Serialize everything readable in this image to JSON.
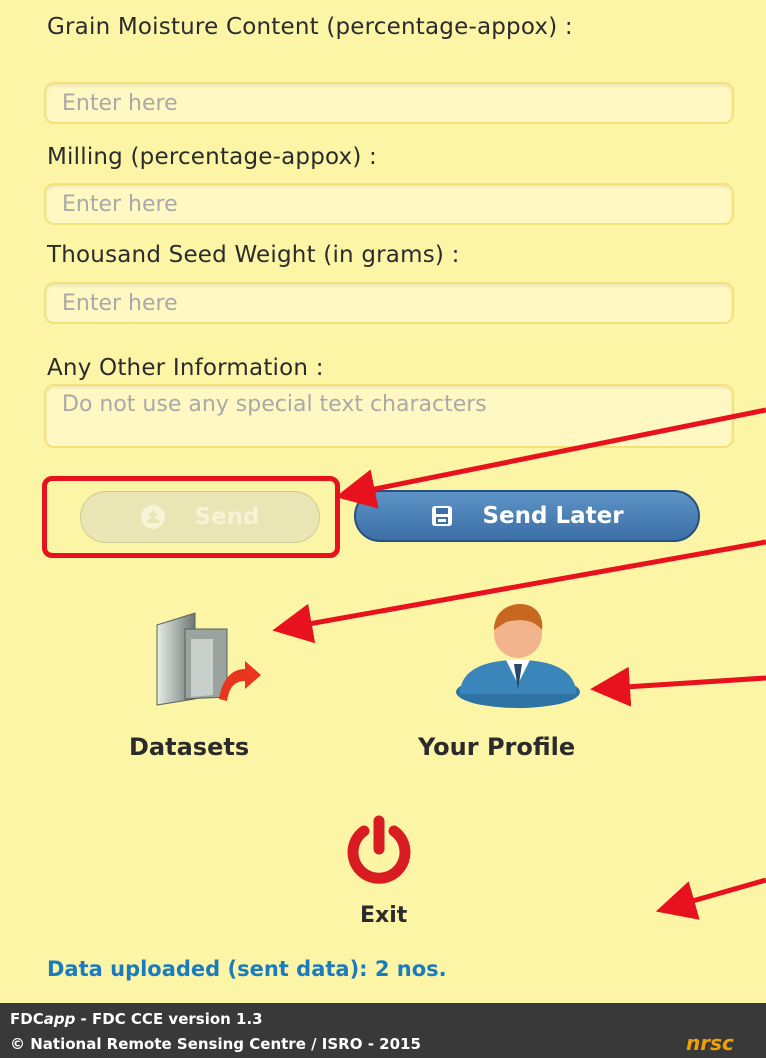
{
  "fields": {
    "grain_moisture": {
      "label": "Grain Moisture Content (percentage-appox) :",
      "placeholder": "Enter here",
      "value": ""
    },
    "milling": {
      "label": "Milling (percentage-appox) :",
      "placeholder": "Enter here",
      "value": ""
    },
    "seed_weight": {
      "label": "Thousand Seed Weight (in grams) :",
      "placeholder": "Enter here",
      "value": ""
    },
    "other_info": {
      "label": "Any Other Information :",
      "placeholder": "Do not use any special text characters",
      "value": ""
    }
  },
  "buttons": {
    "send": "Send",
    "send_later": "Send Later"
  },
  "tiles": {
    "datasets": "Datasets",
    "profile": "Your Profile",
    "exit": "Exit"
  },
  "status": "Data uploaded (sent data): 2 nos.",
  "footer": {
    "app_name": "FDC",
    "app_suffix": "app",
    "version_text": " - FDC CCE version 1.3",
    "copyright": "© National Remote Sensing Centre / ISRO - 2015",
    "brand": "nrsc"
  },
  "colors": {
    "background": "#fdf5a6",
    "send_later": "#3b6fa6",
    "annotation": "#e8111e",
    "status_text": "#1a7bc0",
    "footer": "#393939",
    "brand": "#f0a000"
  },
  "icons": [
    "upload-icon",
    "save-icon",
    "datasets-icon",
    "profile-icon",
    "power-icon"
  ]
}
